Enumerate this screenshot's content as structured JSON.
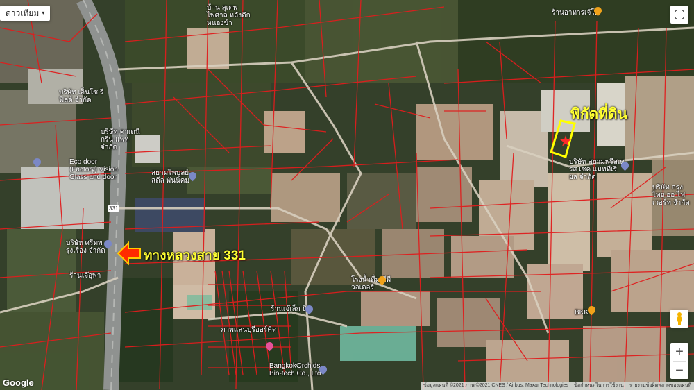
{
  "map_type_label": "ดาวเทียม",
  "tools": [
    "✋",
    "⤢",
    "∿",
    "▢",
    "◯",
    "⊙"
  ],
  "land_label": "พิกัดที่ดิน",
  "highway_label": "ทางหลวงสาย 331",
  "pois": [
    {
      "name": "Eco door (Factory) Vision Glass and door"
    },
    {
      "name": "บริษัท ศรีทพ รุ่งเรือง จำกัด"
    },
    {
      "name": "ร้านเจ๊อุพา"
    },
    {
      "name": "โรงน้ำดื่ม พีพีวอเตอร์"
    },
    {
      "name": "ร้านเจ๊เล็ก นิด"
    },
    {
      "name": "ภาพแสนบุรีออร์คิด"
    },
    {
      "name": "BangkokOrchids Bio-tech Co., Ltd"
    },
    {
      "name": "BKK"
    },
    {
      "name": "บริษัท สยามพรีสเตรส เซค แมททีเรียล จำกัด"
    },
    {
      "name": "บริษัท กรุงไทย ออ ไฟเวอร์ท จำกัด"
    },
    {
      "name": "สยามไพบูลย์ สตีล พันนิคม"
    },
    {
      "name": "บริษัท เอ็นโซ รีฟิลด์ จำกัด"
    },
    {
      "name": "บริษัท คาเดนี กรีน แพท จำกัด"
    },
    {
      "name": "บ้าน สุเตพ ไพศาล หลังตึกหนองข้า"
    },
    {
      "name": "ร้านอาหารเจ๊โอ"
    }
  ],
  "highway_number": "331",
  "google_label": "Google",
  "attribution": [
    "ข้อมูลแผนที่ ©2021 ภาพ ©2021 CNES / Airbus, Maxar Technologies",
    "ข้อกำหนดในการใช้งาน",
    "รายงานข้อผิดพลาดของแผนที่"
  ],
  "zoom_in": "+",
  "zoom_out": "−"
}
